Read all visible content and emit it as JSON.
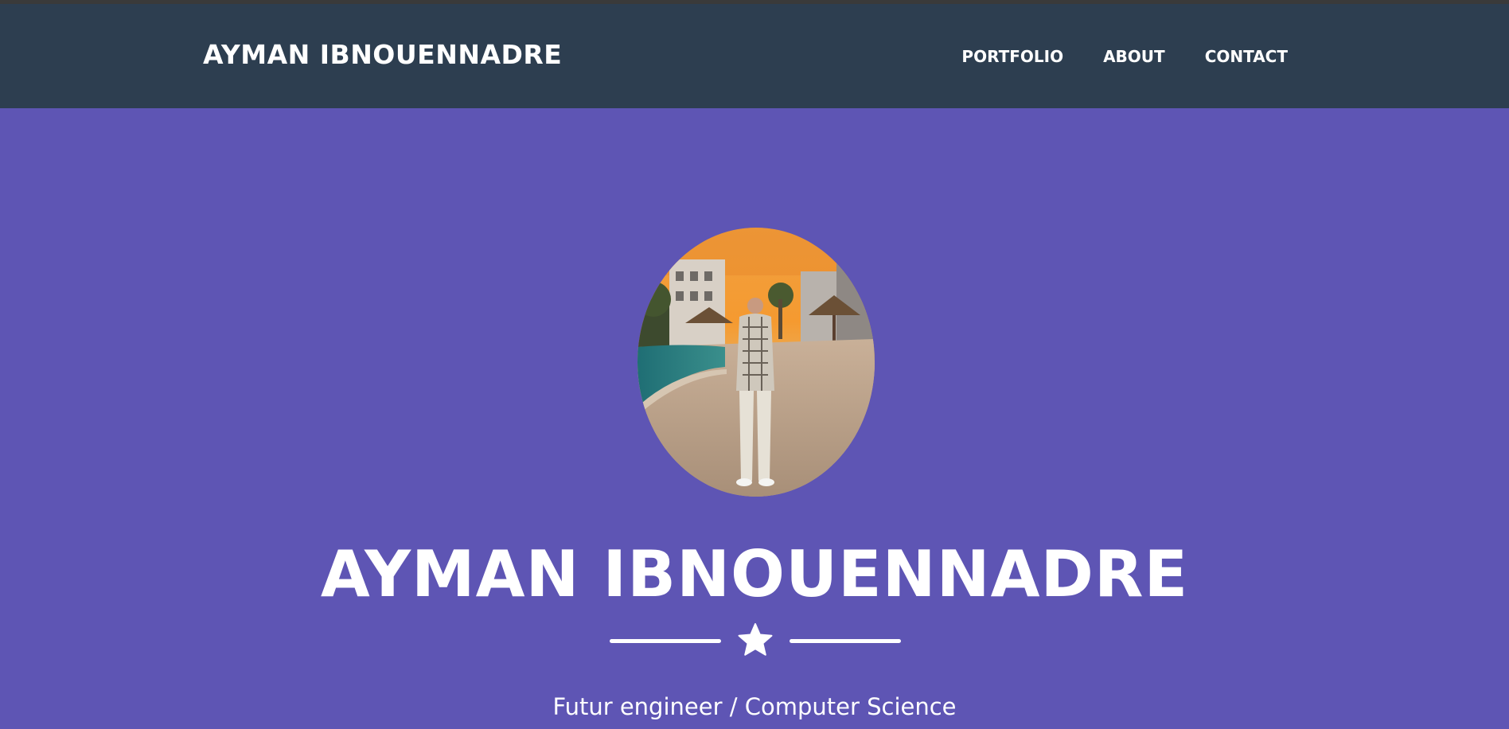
{
  "navbar": {
    "brand": "AYMAN IBNOUENNADRE",
    "links": [
      {
        "label": "PORTFOLIO"
      },
      {
        "label": "ABOUT"
      },
      {
        "label": "CONTACT"
      }
    ]
  },
  "hero": {
    "avatar_icon": "profile-photo",
    "title": "AYMAN IBNOUENNADRE",
    "divider_icon": "star-icon",
    "subtitle": "Futur engineer / Computer Science"
  },
  "colors": {
    "top_strip": "#3a3a3a",
    "navbar_bg": "#2d3e50",
    "hero_bg": "#5e55b4",
    "text": "#ffffff"
  }
}
